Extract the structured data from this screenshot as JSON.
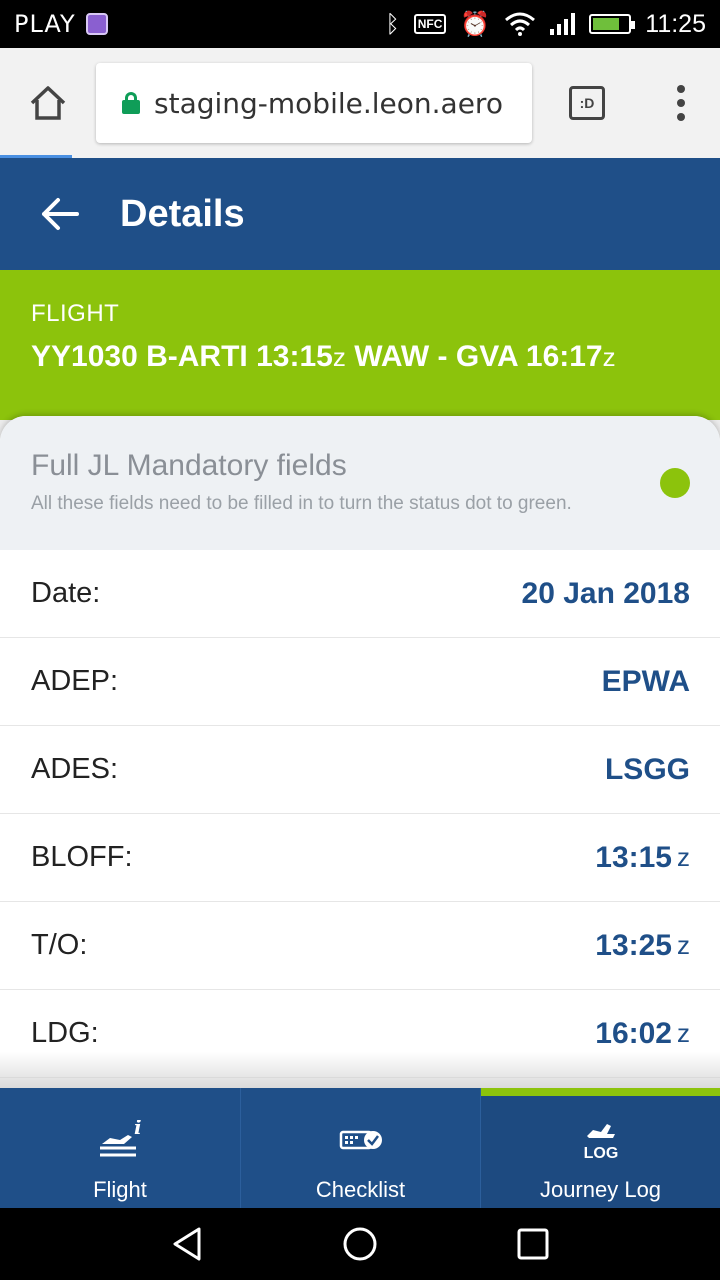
{
  "status_bar": {
    "carrier": "PLAY",
    "nfc_label": "NFC",
    "time": "11:25"
  },
  "browser": {
    "url": "staging-mobile.leon.aero",
    "tabs_label": ":D"
  },
  "app_bar": {
    "title": "Details"
  },
  "flight": {
    "label": "FLIGHT",
    "flight_no": "YY1030",
    "registration": "B-ARTI",
    "dep_time": "13:15",
    "from": "WAW",
    "separator": "-",
    "to": "GVA",
    "arr_time": "16:17",
    "zulu": "z"
  },
  "mandatory": {
    "title": "Full JL Mandatory fields",
    "subtitle": "All these fields need to be filled in to turn the status dot to green.",
    "status_color": "#8cc30c"
  },
  "fields": [
    {
      "label": "Date:",
      "value": "20 Jan 2018",
      "unit": ""
    },
    {
      "label": "ADEP:",
      "value": "EPWA",
      "unit": ""
    },
    {
      "label": "ADES:",
      "value": "LSGG",
      "unit": ""
    },
    {
      "label": "BLOFF:",
      "value": "13:15",
      "unit": "z"
    },
    {
      "label": "T/O:",
      "value": "13:25",
      "unit": "z"
    },
    {
      "label": "LDG:",
      "value": "16:02",
      "unit": "z"
    }
  ],
  "tabs": [
    {
      "label": "Flight",
      "icon": "flight-info-icon",
      "active": false
    },
    {
      "label": "Checklist",
      "icon": "checklist-icon",
      "active": false
    },
    {
      "label": "Journey Log",
      "icon": "journey-log-icon",
      "badge": "LOG",
      "active": true
    }
  ],
  "colors": {
    "primary": "#1f4f88",
    "accent": "#8cc30c"
  }
}
